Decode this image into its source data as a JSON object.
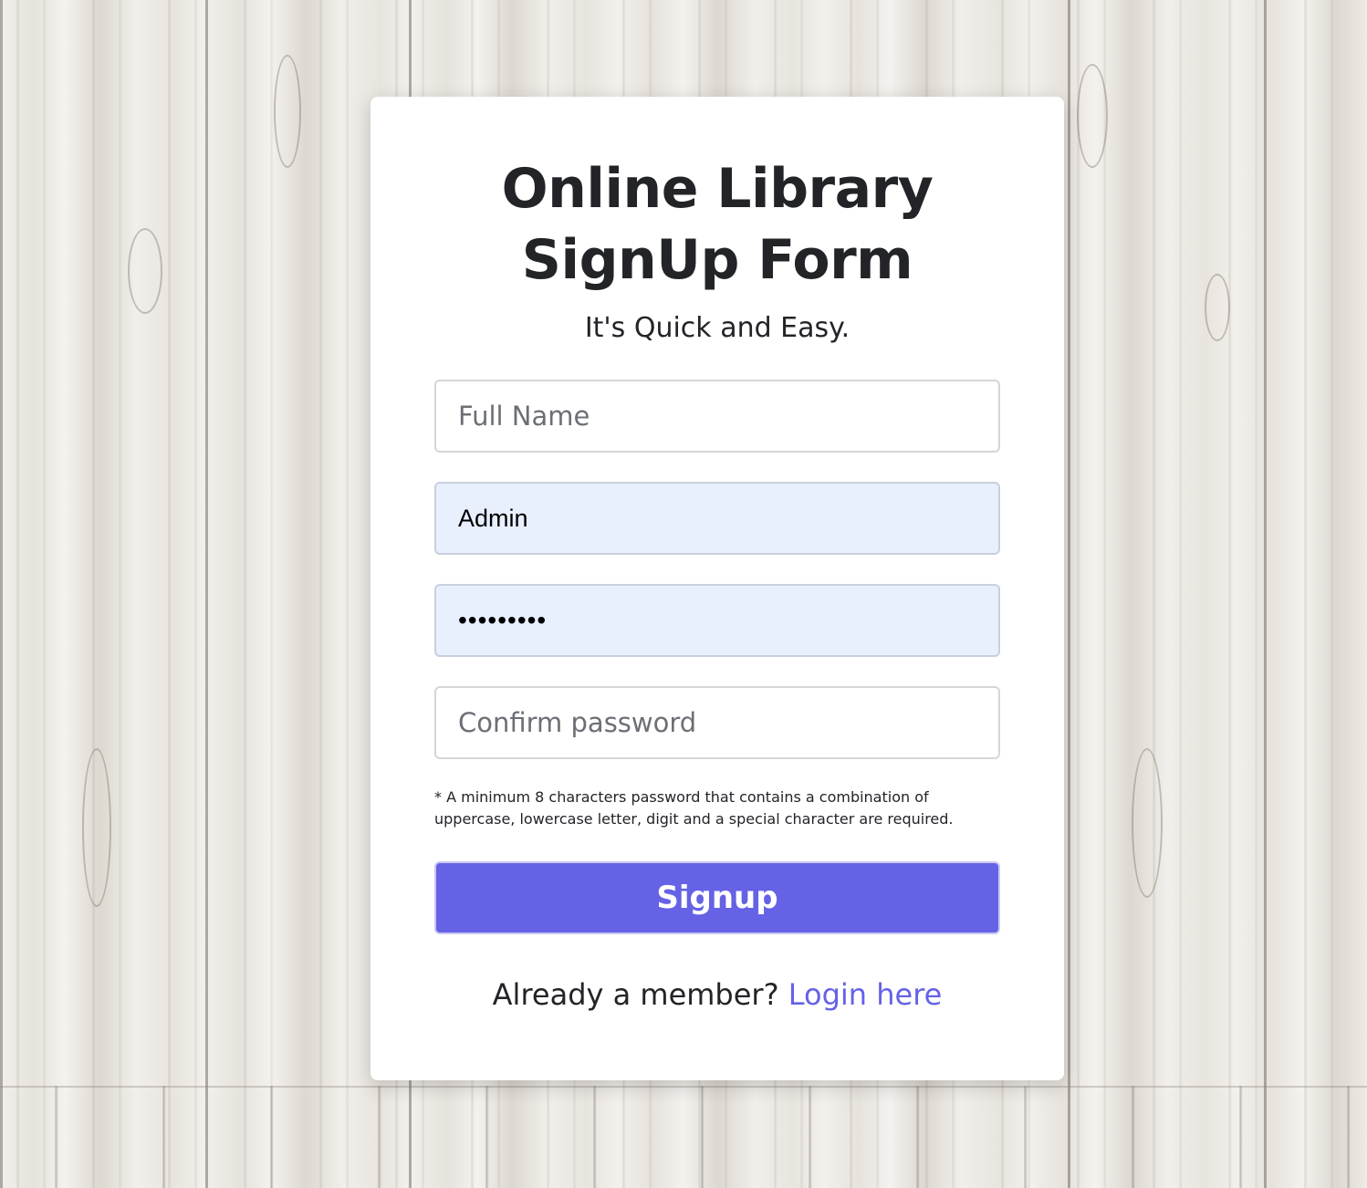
{
  "form": {
    "title_line1": "Online Library",
    "title_line2": "SignUp Form",
    "subtitle": "It's Quick and Easy.",
    "fields": {
      "full_name": {
        "placeholder": "Full Name",
        "value": ""
      },
      "username": {
        "placeholder": "",
        "value": "Admin"
      },
      "password": {
        "placeholder": "",
        "value": "•••••••••"
      },
      "confirm_password": {
        "placeholder": "Confirm password",
        "value": ""
      }
    },
    "password_hint": "* A minimum 8 characters password that contains a combination of uppercase, lowercase letter, digit and a special character are required.",
    "submit_label": "Signup",
    "login_prompt": "Already a member?",
    "login_link": "Login here"
  },
  "colors": {
    "accent": "#6562e6",
    "autofill_bg": "#e8effd",
    "text": "#222428",
    "placeholder": "#6c6f75"
  }
}
